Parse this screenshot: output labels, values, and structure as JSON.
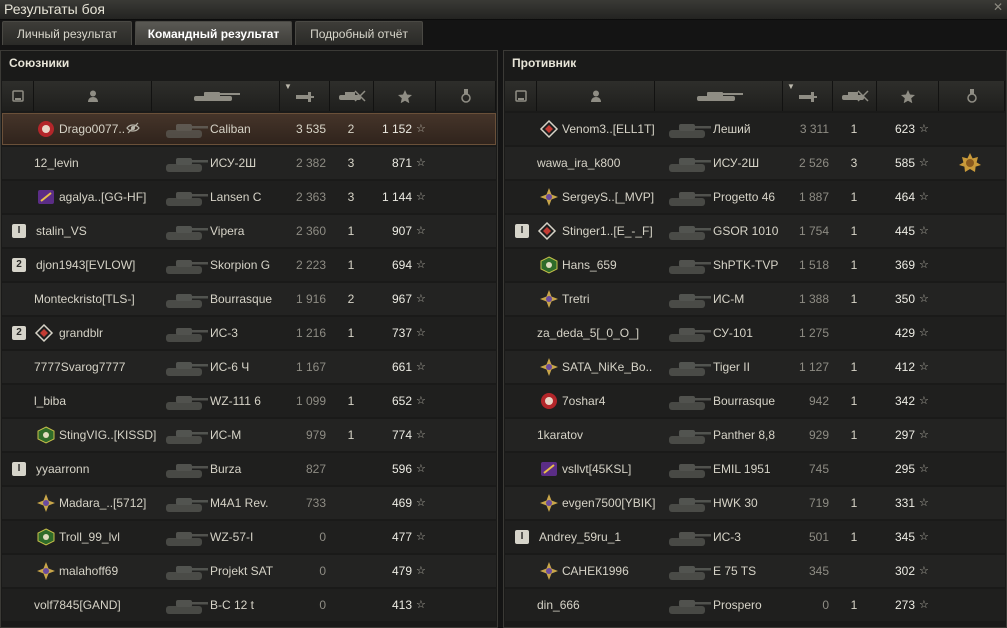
{
  "window": {
    "title": "Результаты боя"
  },
  "tabs": [
    {
      "label": "Личный результат",
      "active": false
    },
    {
      "label": "Командный результат",
      "active": true
    },
    {
      "label": "Подробный отчёт",
      "active": false
    }
  ],
  "allies": {
    "title": "Союзники",
    "rows": [
      {
        "badge": "",
        "emblem": "red-clan-icon",
        "name": "Drago0077..",
        "tank": "Caliban",
        "damage": "3 535",
        "kills": "2",
        "xp": "1 152",
        "highlight": true,
        "eye": true
      },
      {
        "badge": "",
        "emblem": "",
        "name": "12_levin",
        "tank": "ИСУ-2Ш",
        "damage": "2 382",
        "kills": "3",
        "xp": "871"
      },
      {
        "badge": "",
        "emblem": "purple-clan-icon",
        "name": "agalya..[GG-HF]",
        "tank": "Lansen C",
        "damage": "2 363",
        "kills": "3",
        "xp": "1 144"
      },
      {
        "badge": "I",
        "emblem": "",
        "name": "stalin_VS",
        "tank": "Vipera",
        "damage": "2 360",
        "kills": "1",
        "xp": "907"
      },
      {
        "badge": "2",
        "emblem": "",
        "name": "djon1943[EVLOW]",
        "tank": "Skorpion G",
        "damage": "2 223",
        "kills": "1",
        "xp": "694"
      },
      {
        "badge": "",
        "emblem": "",
        "name": "Monteckristo[TLS-]",
        "tank": "Bourrasque",
        "damage": "1 916",
        "kills": "2",
        "xp": "967"
      },
      {
        "badge": "2",
        "emblem": "diamond-clan-icon",
        "name": "grandblr",
        "tank": "ИС-3",
        "damage": "1 216",
        "kills": "1",
        "xp": "737"
      },
      {
        "badge": "",
        "emblem": "",
        "name": "7777Svarog7777",
        "tank": "ИС-6 Ч",
        "damage": "1 167",
        "kills": "",
        "xp": "661"
      },
      {
        "badge": "",
        "emblem": "",
        "name": "l_biba",
        "tank": "WZ-111 6",
        "damage": "1 099",
        "kills": "1",
        "xp": "652"
      },
      {
        "badge": "",
        "emblem": "green-clan-icon",
        "name": "StingVIG..[KISSD]",
        "tank": "ИС-М",
        "damage": "979",
        "kills": "1",
        "xp": "774"
      },
      {
        "badge": "I",
        "emblem": "",
        "name": "yyaarronn",
        "tank": "Burza",
        "damage": "827",
        "kills": "",
        "xp": "596"
      },
      {
        "badge": "",
        "emblem": "gold-clan-icon",
        "name": "Madara_..[5712]",
        "tank": "M4A1 Rev.",
        "damage": "733",
        "kills": "",
        "xp": "469"
      },
      {
        "badge": "",
        "emblem": "green-clan-icon",
        "name": "Troll_99_lvl",
        "tank": "WZ-57-I",
        "damage": "0",
        "kills": "",
        "xp": "477"
      },
      {
        "badge": "",
        "emblem": "gold-clan-icon",
        "name": "malahoff69",
        "tank": "Projekt SAT",
        "damage": "0",
        "kills": "",
        "xp": "479"
      },
      {
        "badge": "",
        "emblem": "",
        "name": "volf7845[GAND]",
        "tank": "B-C 12 t",
        "damage": "0",
        "kills": "",
        "xp": "413"
      }
    ]
  },
  "enemies": {
    "title": "Противник",
    "rows": [
      {
        "badge": "",
        "emblem": "diamond-clan-icon",
        "name": "Venom3..[ELL1T]",
        "tank": "Леший",
        "damage": "3 311",
        "kills": "1",
        "xp": "623"
      },
      {
        "badge": "",
        "emblem": "",
        "name": "wawa_ira_k800",
        "tank": "ИСУ-2Ш",
        "damage": "2 526",
        "kills": "3",
        "xp": "585",
        "medal": true
      },
      {
        "badge": "",
        "emblem": "gold-clan-icon",
        "name": "SergeyS..[_MVP]",
        "tank": "Progetto 46",
        "damage": "1 887",
        "kills": "1",
        "xp": "464"
      },
      {
        "badge": "I",
        "emblem": "diamond-clan-icon",
        "name": "Stinger1..[E_-_F]",
        "tank": "GSOR 1010",
        "damage": "1 754",
        "kills": "1",
        "xp": "445"
      },
      {
        "badge": "",
        "emblem": "green-clan-icon",
        "name": "Hans_659",
        "tank": "ShPTK-TVP",
        "damage": "1 518",
        "kills": "1",
        "xp": "369"
      },
      {
        "badge": "",
        "emblem": "gold-clan-icon",
        "name": "Tretri",
        "tank": "ИС-М",
        "damage": "1 388",
        "kills": "1",
        "xp": "350"
      },
      {
        "badge": "",
        "emblem": "",
        "name": "za_deda_5[_0_O_]",
        "tank": "СУ-101",
        "damage": "1 275",
        "kills": "",
        "xp": "429"
      },
      {
        "badge": "",
        "emblem": "gold-clan-icon",
        "name": "SATA_NiKe_Bo..",
        "tank": "Tiger II",
        "damage": "1 127",
        "kills": "1",
        "xp": "412"
      },
      {
        "badge": "",
        "emblem": "red-clan-icon",
        "name": "7oshar4",
        "tank": "Bourrasque",
        "damage": "942",
        "kills": "1",
        "xp": "342"
      },
      {
        "badge": "",
        "emblem": "",
        "name": "1karatov",
        "tank": "Panther 8,8",
        "damage": "929",
        "kills": "1",
        "xp": "297"
      },
      {
        "badge": "",
        "emblem": "purple-clan-icon",
        "name": "vsllvt[45KSL]",
        "tank": "EMIL 1951",
        "damage": "745",
        "kills": "",
        "xp": "295"
      },
      {
        "badge": "",
        "emblem": "gold-clan-icon",
        "name": "evgen7500[YBIK]",
        "tank": "HWK 30",
        "damage": "719",
        "kills": "1",
        "xp": "331"
      },
      {
        "badge": "I",
        "emblem": "",
        "name": "Andrey_59ru_1",
        "tank": "ИС-3",
        "damage": "501",
        "kills": "1",
        "xp": "345"
      },
      {
        "badge": "",
        "emblem": "gold-clan-icon",
        "name": "САНЕК1996",
        "tank": "E 75 TS",
        "damage": "345",
        "kills": "",
        "xp": "302"
      },
      {
        "badge": "",
        "emblem": "",
        "name": "din_666",
        "tank": "Prospero",
        "damage": "0",
        "kills": "1",
        "xp": "273"
      }
    ]
  },
  "colors": {
    "highlight": "#46352a",
    "row": "#1f1f1e",
    "xp": "#ecebe3"
  }
}
